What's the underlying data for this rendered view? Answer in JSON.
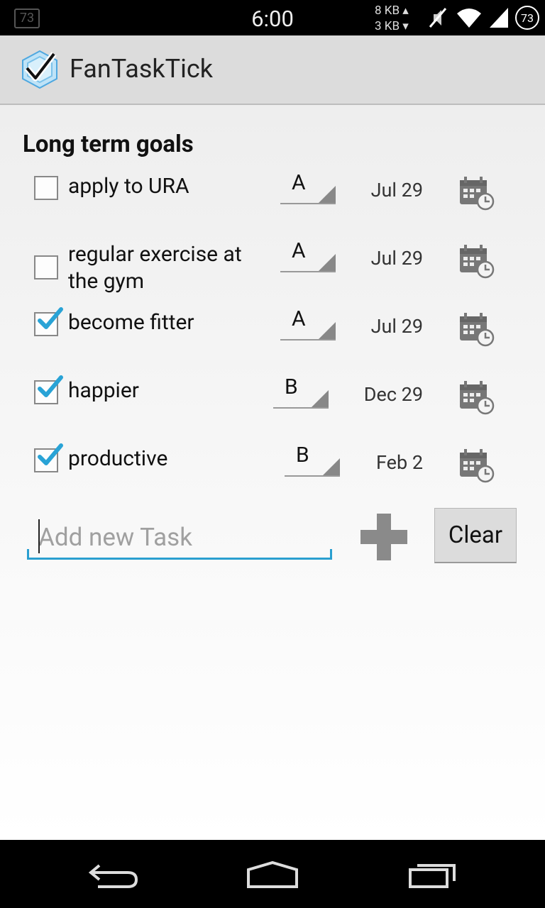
{
  "status_bar": {
    "time": "6:00",
    "notification_count": "73",
    "net_up": "8 KB ▴",
    "net_down": "3 KB ▾",
    "battery_level": "73",
    "icons": [
      "mute-icon",
      "wifi-icon",
      "signal-icon",
      "battery-icon"
    ]
  },
  "app": {
    "title": "FanTaskTick",
    "logo_icon": "checkmark-hexagon-icon"
  },
  "section": {
    "title": "Long term goals"
  },
  "tasks": [
    {
      "label": "apply to URA",
      "checked": false,
      "priority": "A",
      "date": "Jul 29"
    },
    {
      "label": "regular exercise at the gym",
      "checked": false,
      "priority": "A",
      "date": "Jul 29"
    },
    {
      "label": "become fitter",
      "checked": true,
      "priority": "A",
      "date": "Jul 29"
    },
    {
      "label": "happier",
      "checked": true,
      "priority": "B",
      "date": "Dec 29"
    },
    {
      "label": "productive",
      "checked": true,
      "priority": "B",
      "date": "Feb 2"
    }
  ],
  "new_task": {
    "placeholder": "Add new Task",
    "value": ""
  },
  "buttons": {
    "add_icon": "plus-icon",
    "clear_label": "Clear"
  },
  "nav": {
    "icons": [
      "back-icon",
      "home-icon",
      "recent-apps-icon"
    ]
  },
  "colors": {
    "accent": "#2a9fd0",
    "check": "#29a3d6",
    "action_bar": "#dcdcdc"
  }
}
